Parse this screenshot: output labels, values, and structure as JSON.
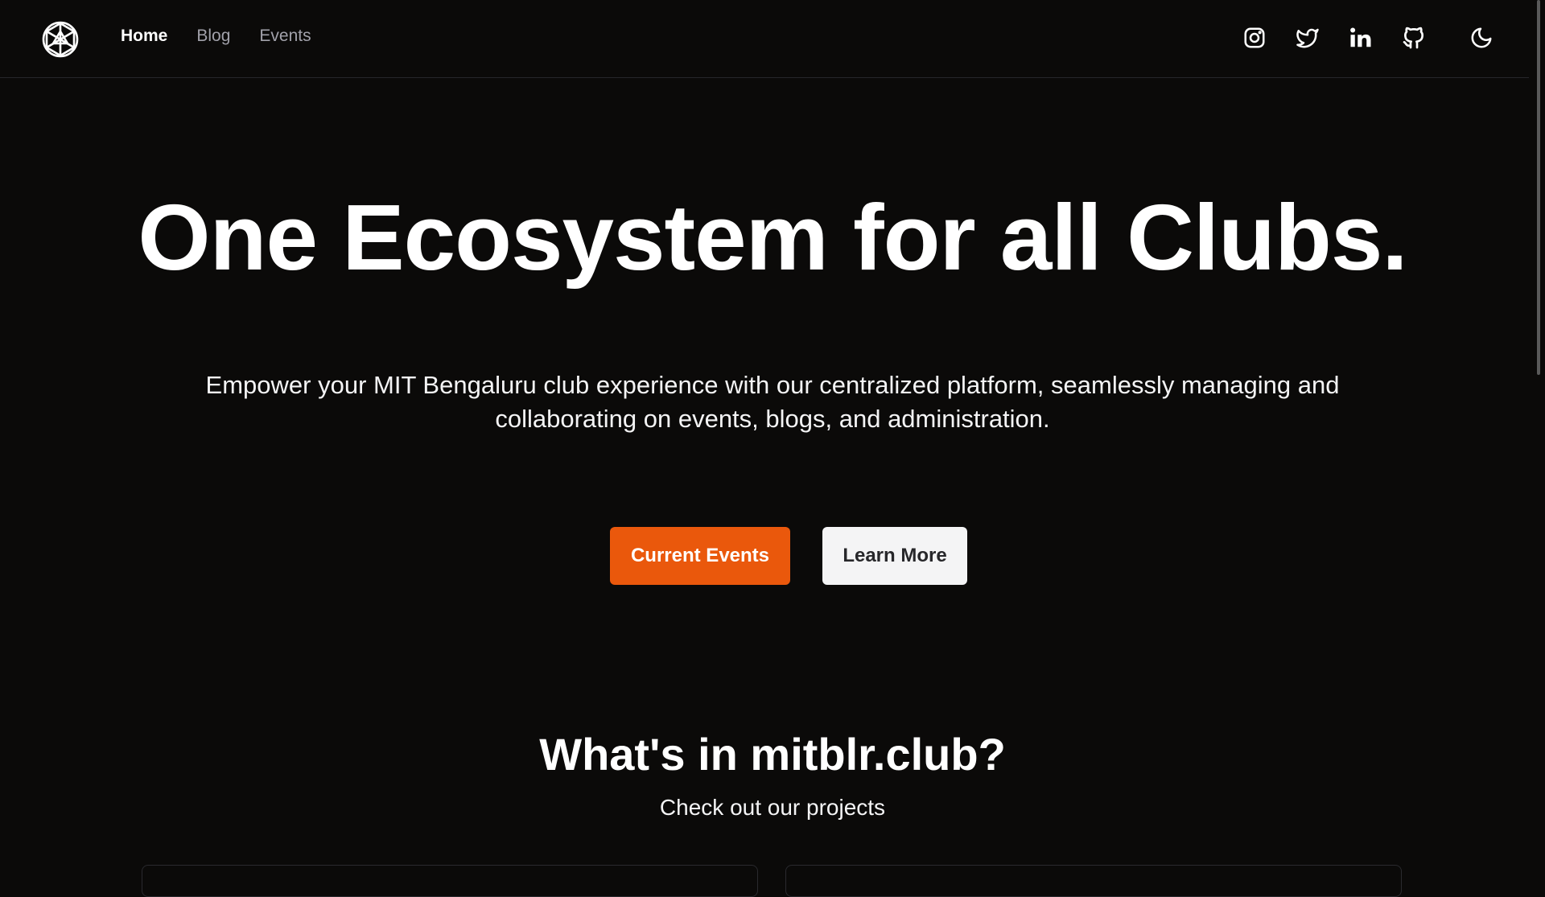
{
  "nav": {
    "logo_icon": "hexagon-star-logo-icon",
    "links": [
      {
        "label": "Home",
        "active": true
      },
      {
        "label": "Blog",
        "active": false
      },
      {
        "label": "Events",
        "active": false
      }
    ],
    "social_icons": [
      "instagram-icon",
      "twitter-icon",
      "linkedin-icon",
      "github-icon"
    ],
    "theme_icon": "moon-icon"
  },
  "hero": {
    "title": "One Ecosystem for all Clubs.",
    "description": "Empower your MIT Bengaluru club experience with our centralized platform, seamlessly managing and collaborating on events, blogs, and administration.",
    "primary_button": "Current Events",
    "secondary_button": "Learn More"
  },
  "projects": {
    "title": "What's in mitblr.club?",
    "subtitle": "Check out our projects"
  },
  "colors": {
    "background": "#0b0a09",
    "accent": "#ea580c",
    "secondary_button": "#f4f4f5"
  }
}
